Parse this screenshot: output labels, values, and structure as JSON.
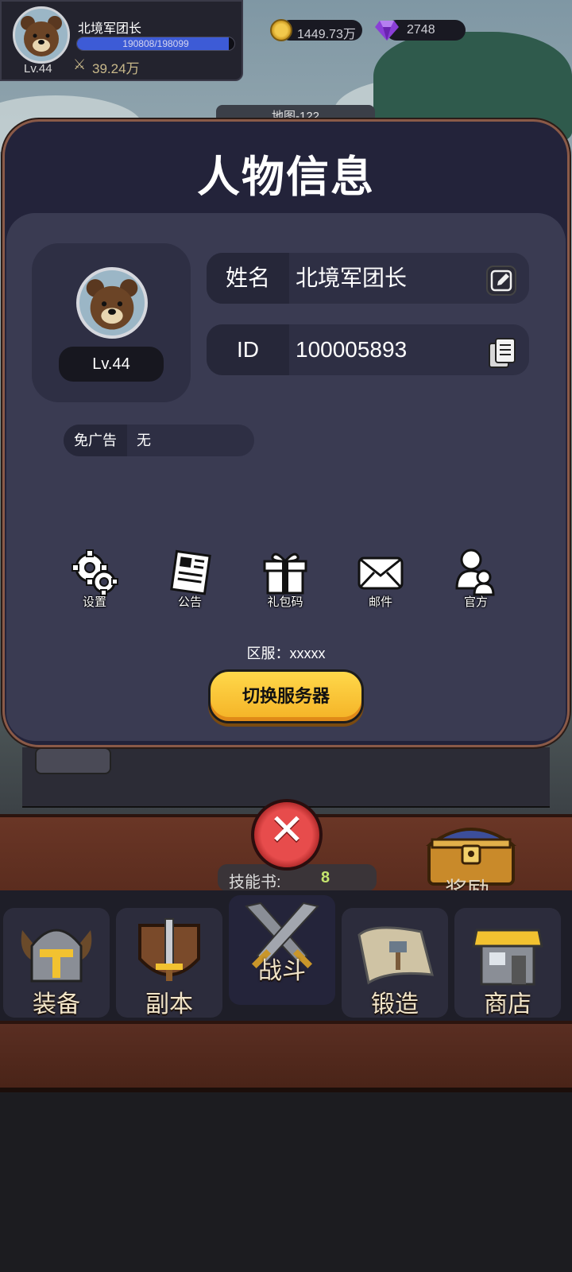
{
  "hud": {
    "player_name": "北境军团长",
    "level": "Lv.44",
    "xp_text": "190808/198099",
    "xp_fraction": 0.963,
    "power": "39.24万",
    "coins": "1449.73万",
    "gems": "2748"
  },
  "scene": {
    "map_label": "地图-122"
  },
  "profile": {
    "title": "人物信息",
    "level_badge": "Lv.44",
    "name_key": "姓名",
    "name_value": "北境军团长",
    "id_key": "ID",
    "id_value": "100005893",
    "noad_key": "免广告",
    "noad_value": "无",
    "menu": [
      {
        "label": "设置",
        "icon": "gear-icon"
      },
      {
        "label": "公告",
        "icon": "newspaper-icon"
      },
      {
        "label": "礼包码",
        "icon": "gift-icon"
      },
      {
        "label": "邮件",
        "icon": "mail-icon"
      },
      {
        "label": "官方",
        "icon": "person-icon"
      }
    ],
    "server_text": "区服：xxxxx",
    "switch_label": "切换服务器"
  },
  "bottom": {
    "skill_label": "技能书:",
    "skill_count": "8",
    "reward_label": "奖励",
    "nav": [
      {
        "label": "装备",
        "icon": "helmet-icon"
      },
      {
        "label": "副本",
        "icon": "sword-shield-icon"
      },
      {
        "label": "战斗",
        "icon": "crossed-swords-icon"
      },
      {
        "label": "锻造",
        "icon": "scroll-hammer-icon"
      },
      {
        "label": "商店",
        "icon": "shop-icon"
      }
    ]
  },
  "colors": {
    "accent_button": "#f4b226",
    "close_button": "#e74c4c",
    "gem": "#8a3fd6",
    "xp_bar": "#3d5bd6",
    "skill_count": "#c4e36d"
  }
}
